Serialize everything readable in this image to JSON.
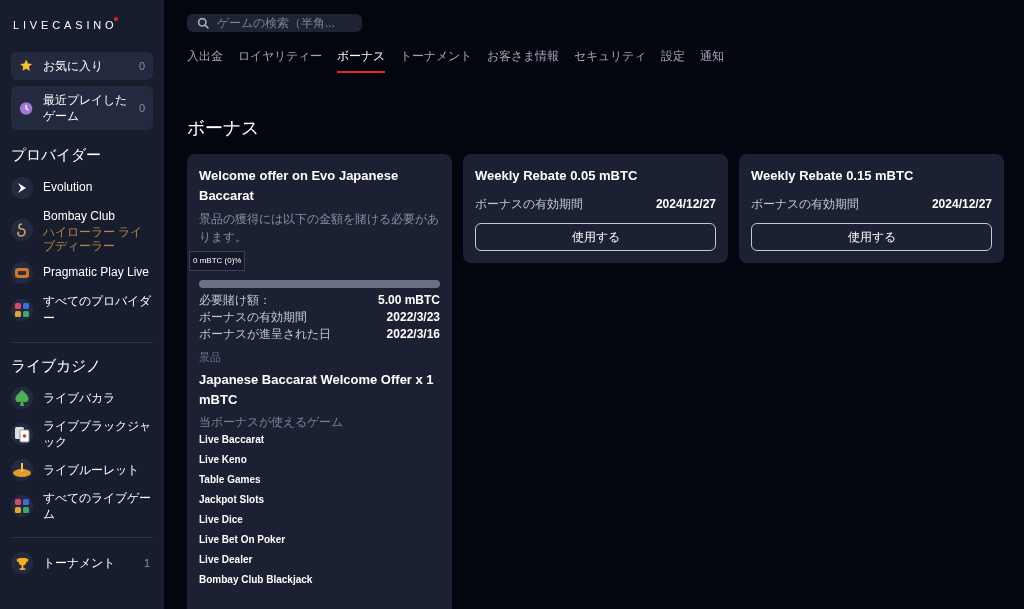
{
  "logo": "LIVECASINO",
  "sidebar": {
    "quick_items": [
      {
        "label": "お気に入り",
        "count": "0"
      },
      {
        "label": "最近プレイしたゲーム",
        "count": "0"
      }
    ],
    "providers_heading": "プロバイダー",
    "providers": [
      {
        "label": "Evolution"
      },
      {
        "label": "Bombay Club",
        "subtitle": "ハイローラー ライブディーラー"
      },
      {
        "label": "Pragmatic Play Live"
      },
      {
        "label": "すべてのプロバイダー"
      }
    ],
    "live_heading": "ライブカジノ",
    "live_items": [
      {
        "label": "ライブバカラ"
      },
      {
        "label": "ライブブラックジャック"
      },
      {
        "label": "ライブルーレット"
      },
      {
        "label": "すべてのライブゲーム"
      }
    ],
    "tournament": {
      "label": "トーナメント",
      "count": "1"
    }
  },
  "search": {
    "placeholder": "ゲームの検索（半角..."
  },
  "tabs": [
    {
      "label": "入出金",
      "selected": false
    },
    {
      "label": "ロイヤリティー",
      "selected": false
    },
    {
      "label": "ボーナス",
      "selected": true
    },
    {
      "label": "トーナメント",
      "selected": false
    },
    {
      "label": "お客さま情報",
      "selected": false
    },
    {
      "label": "セキュリティ",
      "selected": false
    },
    {
      "label": "設定",
      "selected": false
    },
    {
      "label": "通知",
      "selected": false
    }
  ],
  "page_title": "ボーナス",
  "bonus_cards": [
    {
      "kind": "wager",
      "title": "Welcome offer on Evo Japanese Baccarat",
      "description": "景品の獲得には以下の金額を賭ける必要があります。",
      "progress_label": "0 mBTC (0)%",
      "level": 0,
      "details": [
        {
          "label": "必要賭け額：",
          "value": "5.00 mBTC"
        },
        {
          "label": "ボーナスの有効期間",
          "value": "2022/3/23"
        },
        {
          "label": "ボーナスが進呈された日",
          "value": "2022/3/16"
        }
      ],
      "prize_label": "景品",
      "prize": "Japanese Baccarat Welcome Offer x 1 mBTC",
      "games_label": "当ボーナスが使えるゲーム",
      "games": [
        "Live Baccarat",
        "Live Keno",
        "Table Games",
        "Jackpot Slots",
        "Live Dice",
        "Live Bet On Poker",
        "Live Dealer",
        "Bombay Club Blackjack"
      ]
    },
    {
      "kind": "rebate",
      "title": "Weekly Rebate 0.05 mBTC",
      "details": [
        {
          "label": "ボーナスの有効期間",
          "value": "2024/12/27"
        }
      ],
      "button": "使用する"
    },
    {
      "kind": "rebate",
      "title": "Weekly Rebate 0.15 mBTC",
      "details": [
        {
          "label": "ボーナスの有効期間",
          "value": "2024/12/27"
        }
      ],
      "button": "使用する"
    }
  ]
}
